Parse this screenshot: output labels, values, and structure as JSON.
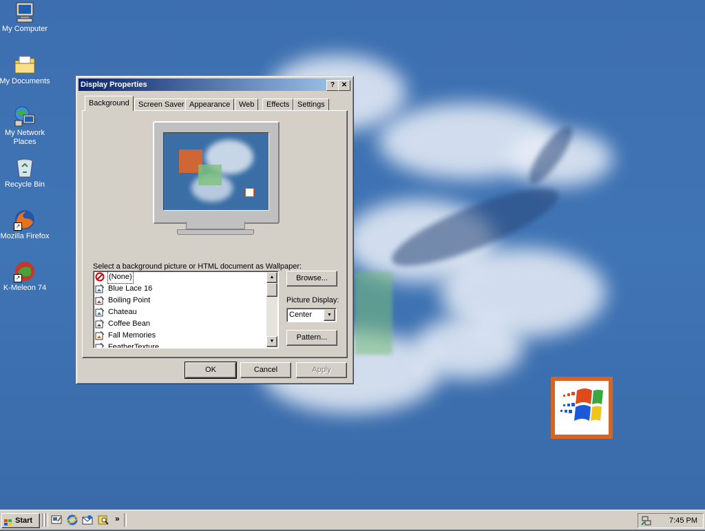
{
  "desktop": {
    "icons": [
      {
        "label": "My Computer",
        "icon": "computer-icon"
      },
      {
        "label": "My Documents",
        "icon": "folder-documents-icon"
      },
      {
        "label": "My Network Places",
        "icon": "network-places-icon"
      },
      {
        "label": "Recycle Bin",
        "icon": "recycle-bin-icon"
      },
      {
        "label": "Mozilla Firefox",
        "icon": "firefox-icon"
      },
      {
        "label": "K-Meleon 74",
        "icon": "kmeleon-icon"
      }
    ]
  },
  "dialog": {
    "title": "Display Properties",
    "help_button": "?",
    "close_button": "✕",
    "tabs": [
      {
        "label": "Background",
        "active": true
      },
      {
        "label": "Screen Saver"
      },
      {
        "label": "Appearance"
      },
      {
        "label": "Web"
      },
      {
        "label": "Effects"
      },
      {
        "label": "Settings"
      }
    ],
    "prompt": "Select a background picture or HTML document as Wallpaper:",
    "wallpapers": [
      {
        "label": "(None)",
        "icon": "none-icon",
        "selected": true
      },
      {
        "label": "Blue Lace 16",
        "icon": "bitmap-icon"
      },
      {
        "label": "Boiling Point",
        "icon": "bitmap-icon"
      },
      {
        "label": "Chateau",
        "icon": "bitmap-icon"
      },
      {
        "label": "Coffee Bean",
        "icon": "bitmap-icon"
      },
      {
        "label": "Fall Memories",
        "icon": "bitmap-icon"
      },
      {
        "label": "FeatherTexture",
        "icon": "bitmap-icon"
      }
    ],
    "browse_label": "Browse...",
    "picture_display_label": "Picture Display:",
    "picture_display_value": "Center",
    "pattern_label": "Pattern...",
    "ok_label": "OK",
    "cancel_label": "Cancel",
    "apply_label": "Apply"
  },
  "taskbar": {
    "start_label": "Start",
    "quick_launch": [
      "show-desktop-icon",
      "internet-explorer-icon",
      "outlook-express-icon",
      "search-icon"
    ],
    "overflow_label": "»",
    "clock": "7:45 PM"
  },
  "colors": {
    "desktop": "#3a6ea5",
    "titlebar_start": "#0a246a",
    "titlebar_end": "#a6caf0",
    "face": "#d4d0c8"
  }
}
